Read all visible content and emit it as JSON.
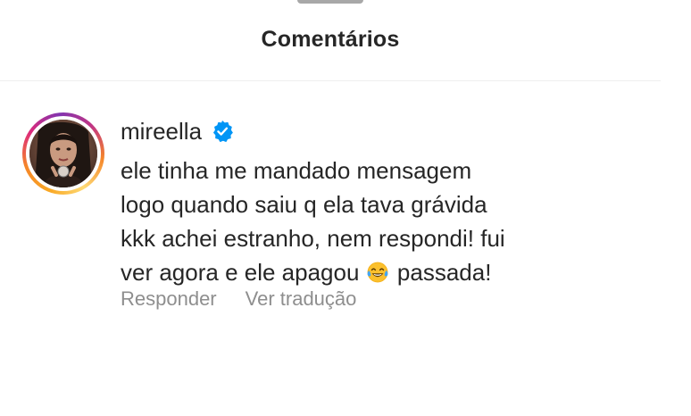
{
  "sheet": {
    "title": "Comentários"
  },
  "comment": {
    "username": "mireella",
    "verified": true,
    "text_lines": [
      "ele tinha me mandado mensagem",
      "logo quando saiu q ela tava grávida",
      "kkk achei estranho, nem respondi! fui"
    ],
    "last_line_before_emoji": "ver agora e ele apagou",
    "emoji": "face-with-tears-of-joy-icon",
    "last_line_after_emoji": "passada!",
    "actions": {
      "reply": "Responder",
      "translate": "Ver tradução"
    }
  },
  "colors": {
    "text": "#262626",
    "secondary": "#8e8e8e",
    "verified_blue": "#0095f6",
    "divider": "#efefef"
  }
}
